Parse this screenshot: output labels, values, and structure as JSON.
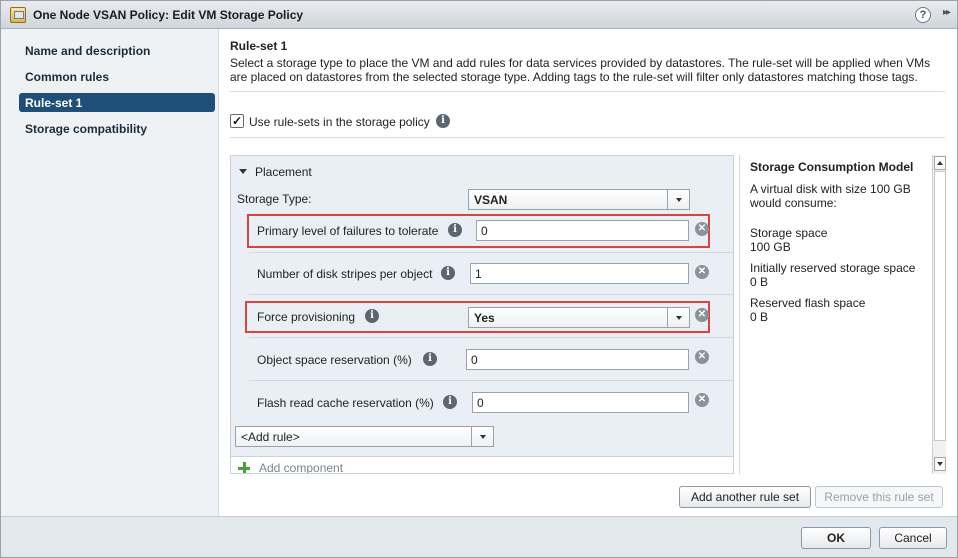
{
  "window": {
    "title": "One Node VSAN Policy: Edit VM Storage Policy",
    "help_glyph": "?",
    "expand_glyph": "▸▸"
  },
  "nav": {
    "items": [
      {
        "label": "Name and description"
      },
      {
        "label": "Common rules"
      },
      {
        "label": "Rule-set 1"
      },
      {
        "label": "Storage compatibility"
      }
    ]
  },
  "ruleset": {
    "title": "Rule-set 1",
    "description": "Select a storage type to place the VM and add rules for data services provided by datastores. The rule-set will be applied when VMs are placed on datastores from the selected storage type. Adding tags to the rule-set will filter only datastores matching those tags.",
    "use_rulesets_label": "Use rule-sets in the storage policy",
    "checkbox_mark": "✓"
  },
  "placement": {
    "header": "Placement",
    "storage_type_label": "Storage Type:",
    "storage_type_value": "VSAN",
    "rules": [
      {
        "label": "Primary level of failures to tolerate",
        "value": "0"
      },
      {
        "label": "Number of disk stripes per object",
        "value": "1"
      },
      {
        "label": "Force provisioning",
        "value": "Yes"
      },
      {
        "label": "Object space reservation (%)",
        "value": "0"
      },
      {
        "label": "Flash read cache reservation (%)",
        "value": "0"
      }
    ],
    "add_rule_value": "<Add rule>",
    "add_component_label": "Add component"
  },
  "consumption": {
    "title": "Storage Consumption Model",
    "intro": "A virtual disk with size 100 GB would consume:",
    "storage_space_label": "Storage space",
    "storage_space_value": "100 GB",
    "initially_reserved_label": "Initially reserved storage space",
    "initially_reserved_value": "0 B",
    "reserved_flash_label": "Reserved flash space",
    "reserved_flash_value": "0 B"
  },
  "buttons": {
    "add_ruleset": "Add another rule set",
    "remove_ruleset": "Remove this rule set",
    "ok": "OK",
    "cancel": "Cancel"
  },
  "icons": {
    "info": "i",
    "remove": "✕"
  },
  "colors": {
    "selected_nav": "#1f4e79",
    "highlight": "#d9443f"
  }
}
